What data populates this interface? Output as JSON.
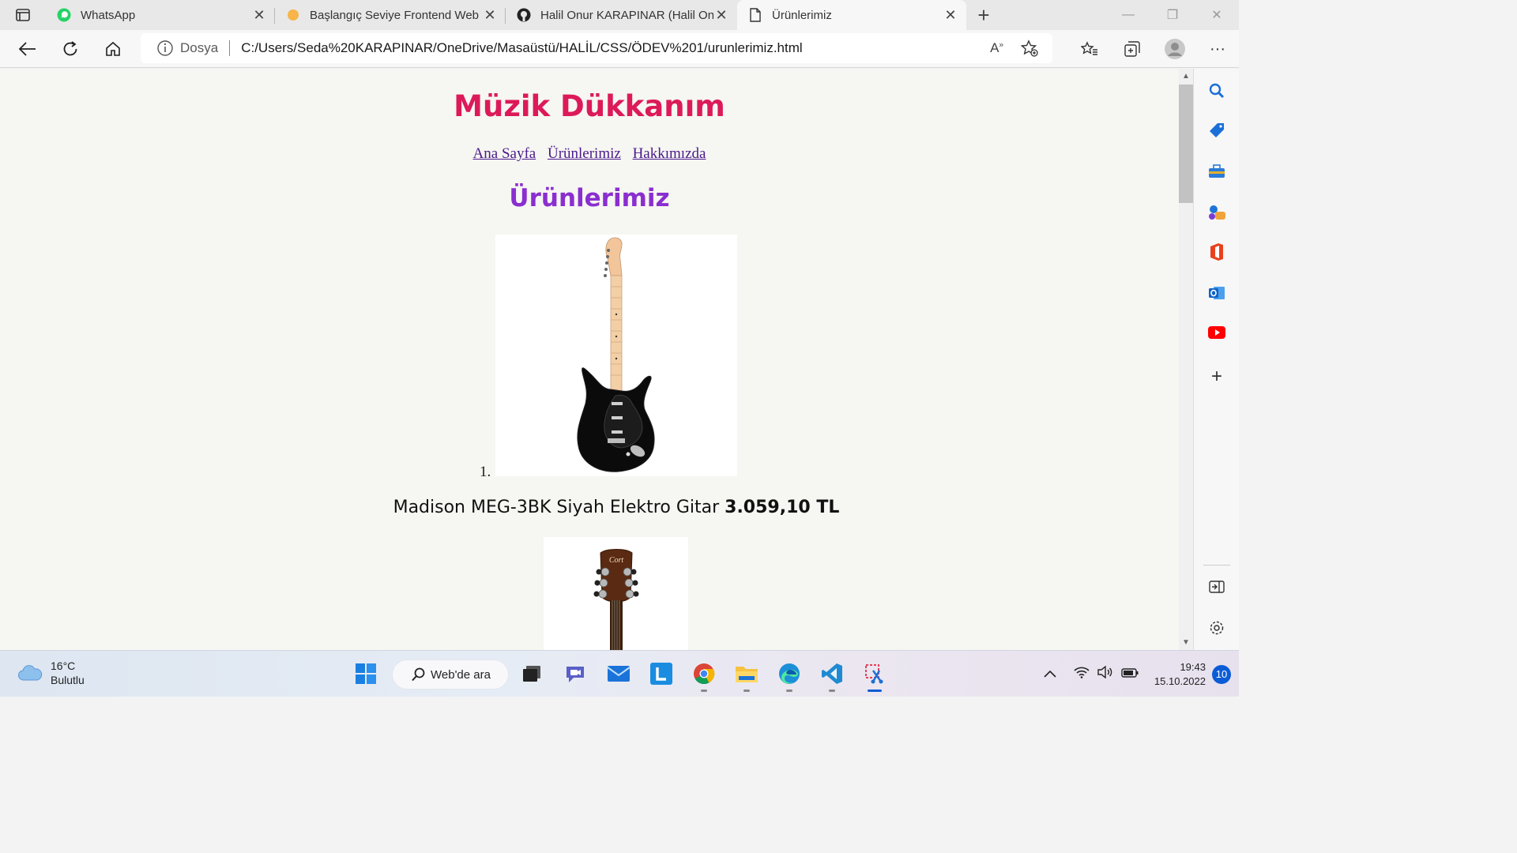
{
  "tabs": [
    {
      "title": "WhatsApp",
      "icon": "whatsapp-icon"
    },
    {
      "title": "Başlangıç Seviye Frontend Web D",
      "icon": "circle-orange-icon"
    },
    {
      "title": "Halil Onur KARAPINAR (Halil Onu",
      "icon": "github-icon"
    },
    {
      "title": "Ürünlerimiz",
      "icon": "page-icon",
      "active": true
    }
  ],
  "address": {
    "protocol_label": "Dosya",
    "url": "C:/Users/Seda%20KARAPINAR/OneDrive/Masaüstü/HALİL/CSS/ÖDEV%201/urunlerimiz.html"
  },
  "page": {
    "title": "Müzik Dükkanım",
    "nav": [
      "Ana Sayfa",
      "Ürünlerimiz",
      "Hakkımızda"
    ],
    "section_title": "Ürünlerimiz",
    "list_number": "1.",
    "product1": {
      "name": "Madison MEG-3BK Siyah Elektro Gitar",
      "price": "3.059,10 TL"
    },
    "product2_brand": "Cort"
  },
  "colors": {
    "title": "#dc1a5a",
    "section_title": "#8a2ed0",
    "link": "#4a1a8c",
    "accent": "#0b5cd5"
  },
  "taskbar": {
    "weather_temp": "16°C",
    "weather_desc": "Bulutlu",
    "search_label": "Web'de ara",
    "time": "19:43",
    "date": "15.10.2022",
    "notifications": "10"
  }
}
